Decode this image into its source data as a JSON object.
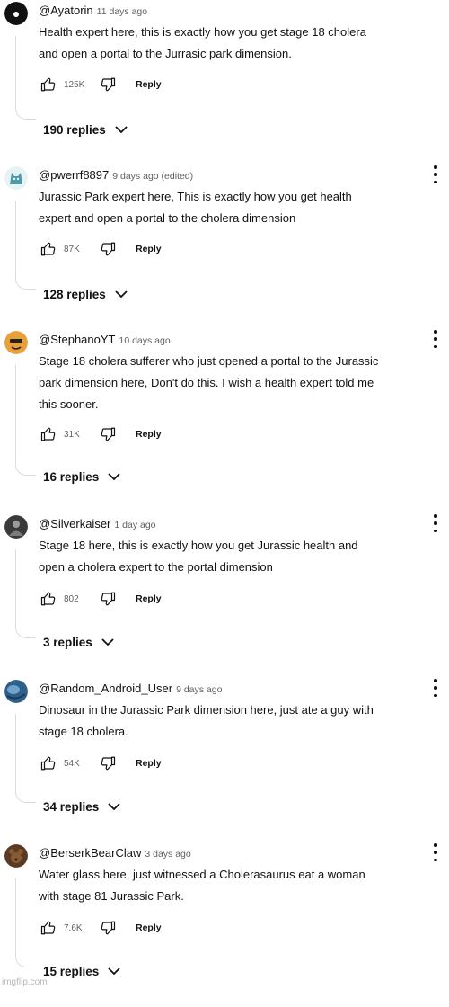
{
  "comments": [
    {
      "author": "@Ayatorin",
      "meta": "11 days ago",
      "lines": [
        "Health expert here, this is exactly how you get stage 18 cholera",
        "and open a portal to the Jurrasic park dimension."
      ],
      "likes": "125K",
      "reply_label": "Reply",
      "replies": "190 replies",
      "avatar_icon": "black-circle-avatar-icon",
      "avatar_color": "#111111"
    },
    {
      "author": "@pwerrf8897",
      "meta": "9 days ago (edited)",
      "lines": [
        "Jurassic Park expert here, This is exactly how you get health",
        "expert and open a portal to the cholera dimension"
      ],
      "likes": "87K",
      "reply_label": "Reply",
      "replies": "128 replies",
      "avatar_icon": "teal-cat-avatar-icon",
      "avatar_color": "#4a9aa8"
    },
    {
      "author": "@StephanoYT",
      "meta": "10 days ago",
      "lines": [
        "Stage 18 cholera sufferer who just opened a portal to the Jurassic",
        "park dimension here, Don't do this. I wish a health expert told me",
        "this sooner."
      ],
      "likes": "31K",
      "reply_label": "Reply",
      "replies": "16 replies",
      "avatar_icon": "orange-face-avatar-icon",
      "avatar_color": "#e8a13a"
    },
    {
      "author": "@Silverkaiser",
      "meta": "1 day ago",
      "lines": [
        "Stage 18 here, this is exactly how you get Jurassic health and",
        "open a cholera expert to the portal dimension"
      ],
      "likes": "802",
      "reply_label": "Reply",
      "replies": "3 replies",
      "avatar_icon": "dark-figure-avatar-icon",
      "avatar_color": "#3a3a3a"
    },
    {
      "author": "@Random_Android_User",
      "meta": "9 days ago",
      "lines": [
        "Dinosaur in the Jurassic Park dimension here, just ate a guy with",
        "stage 18 cholera."
      ],
      "likes": "54K",
      "reply_label": "Reply",
      "replies": "34 replies",
      "avatar_icon": "blue-globe-avatar-icon",
      "avatar_color": "#2e5f8a"
    },
    {
      "author": "@BerserkBearClaw",
      "meta": "3 days ago",
      "lines": [
        "Water glass here, just witnessed a Cholerasaurus eat a woman",
        "with stage 81 Jurassic Park."
      ],
      "likes": "7.6K",
      "reply_label": "Reply",
      "replies": "15 replies",
      "avatar_icon": "brown-bear-avatar-icon",
      "avatar_color": "#5a3a22"
    }
  ],
  "watermark": "imgflip.com"
}
